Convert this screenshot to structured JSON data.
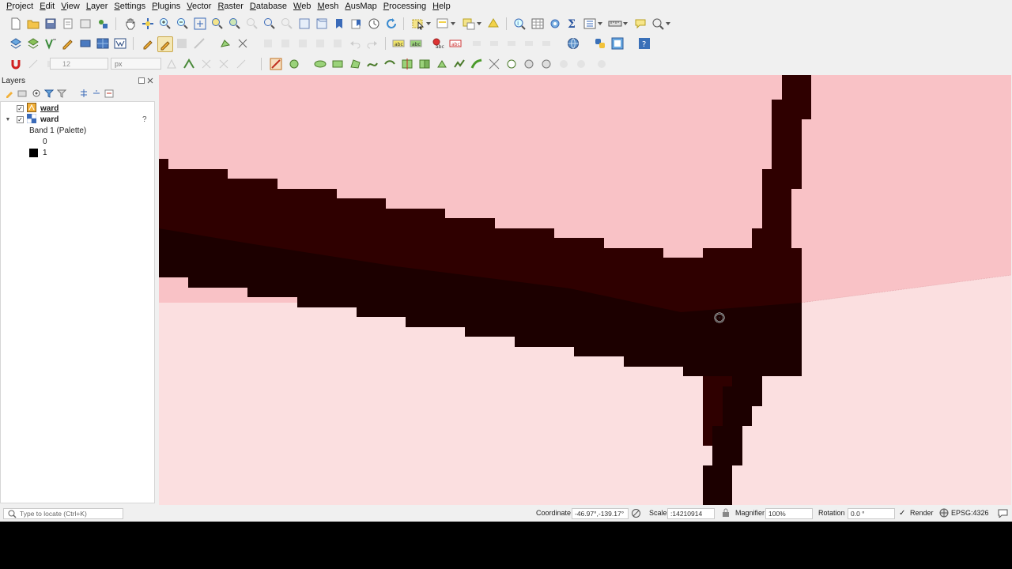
{
  "menu": [
    "Project",
    "Edit",
    "View",
    "Layer",
    "Settings",
    "Plugins",
    "Vector",
    "Raster",
    "Database",
    "Web",
    "Mesh",
    "AusMap",
    "Processing",
    "Help"
  ],
  "toolbar": {
    "size_value": "12",
    "size_unit": "px"
  },
  "layers_panel": {
    "title": "Layers",
    "items": [
      {
        "name": "ward",
        "type": "vector",
        "checked": true
      },
      {
        "name": "ward",
        "type": "raster",
        "checked": true,
        "help": "?"
      }
    ],
    "band_label": "Band 1 (Palette)",
    "legend": [
      {
        "value": "0",
        "color": "#ffffff"
      },
      {
        "value": "1",
        "color": "#000000"
      }
    ]
  },
  "map": {
    "polygon_fill": "#f9c2c6",
    "background_fill": "#fbdfe0",
    "raster_fill": "#2e0000",
    "raster_dark_fill": "#1c0000"
  },
  "statusbar": {
    "locate_placeholder": "Type to locate (Ctrl+K)",
    "coordinate_label": "Coordinate",
    "coordinate_value": "-46.97°,-139.17°",
    "scale_label": "Scale",
    "scale_value": ":14210914",
    "magnifier_label": "Magnifier",
    "magnifier_value": "100%",
    "rotation_label": "Rotation",
    "rotation_value": "0.0 °",
    "render_label": "Render",
    "crs_label": "EPSG:4326"
  }
}
